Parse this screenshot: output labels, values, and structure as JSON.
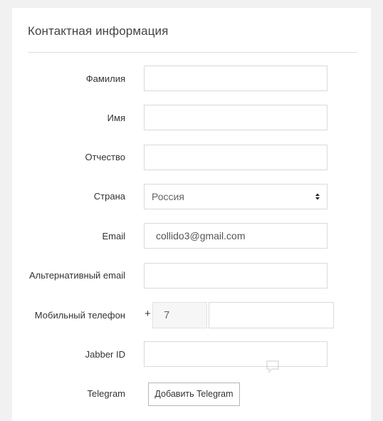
{
  "section": {
    "title": "Контактная информация"
  },
  "form": {
    "last_name": {
      "label": "Фамилия",
      "value": ""
    },
    "first_name": {
      "label": "Имя",
      "value": ""
    },
    "middle_name": {
      "label": "Отчество",
      "value": ""
    },
    "country": {
      "label": "Страна",
      "value": "Россия"
    },
    "email": {
      "label": "Email",
      "value": "collido3@gmail.com"
    },
    "alt_email": {
      "label": "Альтернативный email",
      "value": ""
    },
    "mobile": {
      "label": "Мобильный телефон",
      "prefix": "+",
      "country_code": "7",
      "number": ""
    },
    "jabber": {
      "label": "Jabber ID",
      "value": ""
    },
    "telegram": {
      "label": "Telegram",
      "button_label": "Добавить Telegram"
    }
  },
  "watermark": {
    "icon": "chat-bubble-icon"
  },
  "colors": {
    "background": "#f1f1f1",
    "card": "#ffffff",
    "field_border": "#d9d9d9",
    "code_bg": "#f6f6f6"
  }
}
